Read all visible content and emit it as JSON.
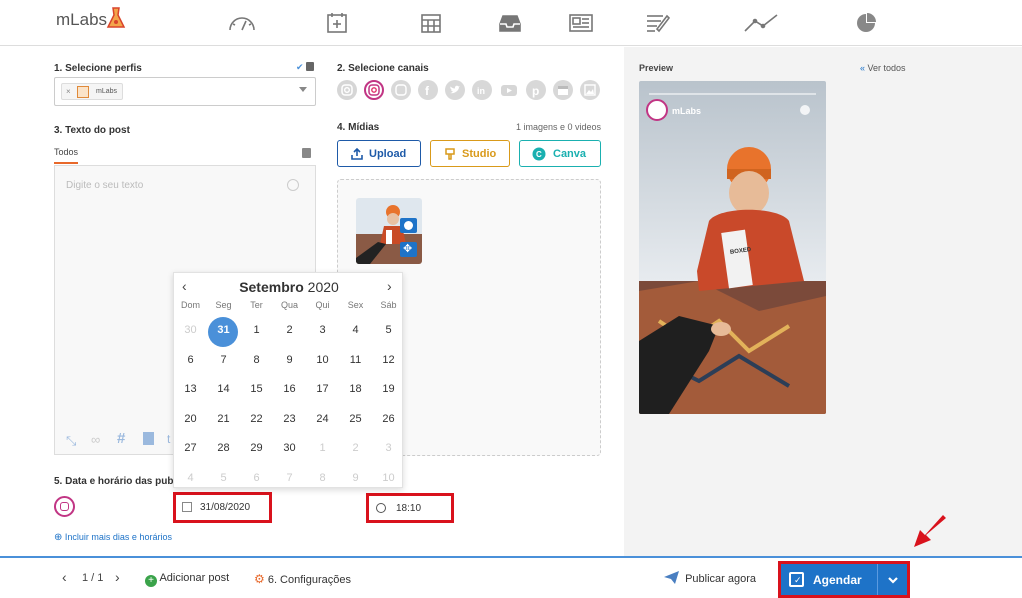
{
  "app": {
    "logo_text": "mLabs"
  },
  "nav": {
    "icons": [
      "dashboard-gauge-icon",
      "add-post-icon",
      "calendar-icon",
      "inbox-icon",
      "report-icon",
      "notes-icon",
      "analytics-icon",
      "pie-chart-icon"
    ]
  },
  "section1": {
    "title": "1. Selecione perfis",
    "chip_label": "mLabs"
  },
  "section2": {
    "title": "2. Selecione canais"
  },
  "section3": {
    "title": "3. Texto do post",
    "tab": "Todos",
    "placeholder": "Digite o seu texto"
  },
  "section4": {
    "title": "4. Mídias",
    "count_text": "1 imagens e 0 videos",
    "upload_label": "Upload",
    "studio_label": "Studio",
    "canva_label": "Canva"
  },
  "section5": {
    "title": "5. Data e horário das publ",
    "date_value": "31/08/2020",
    "time_value": "18:10",
    "more_link": "Incluir mais dias e horários"
  },
  "calendar": {
    "month": "Setembro",
    "year": "2020",
    "weekdays": [
      "Dom",
      "Seg",
      "Ter",
      "Qua",
      "Qui",
      "Sex",
      "Sáb"
    ],
    "weeks": [
      [
        "30",
        "31",
        "1",
        "2",
        "3",
        "4",
        "5"
      ],
      [
        "6",
        "7",
        "8",
        "9",
        "10",
        "11",
        "12"
      ],
      [
        "13",
        "14",
        "15",
        "16",
        "17",
        "18",
        "19"
      ],
      [
        "20",
        "21",
        "22",
        "23",
        "24",
        "25",
        "26"
      ],
      [
        "27",
        "28",
        "29",
        "30",
        "1",
        "2",
        "3"
      ],
      [
        "4",
        "5",
        "6",
        "7",
        "8",
        "9",
        "10"
      ]
    ],
    "selected_day": "31"
  },
  "preview": {
    "title": "Preview",
    "see_all": "Ver todos",
    "account": "mLabs"
  },
  "footer": {
    "pager": "1 / 1",
    "add_post": "Adicionar post",
    "settings": "6. Configurações",
    "publish_now": "Publicar agora",
    "schedule": "Agendar"
  },
  "colors": {
    "accent": "#1e73c8",
    "highlight": "#d9121c",
    "tab_orange": "#e8682a",
    "studio": "#d99a1a",
    "canva": "#1ab0b0"
  }
}
